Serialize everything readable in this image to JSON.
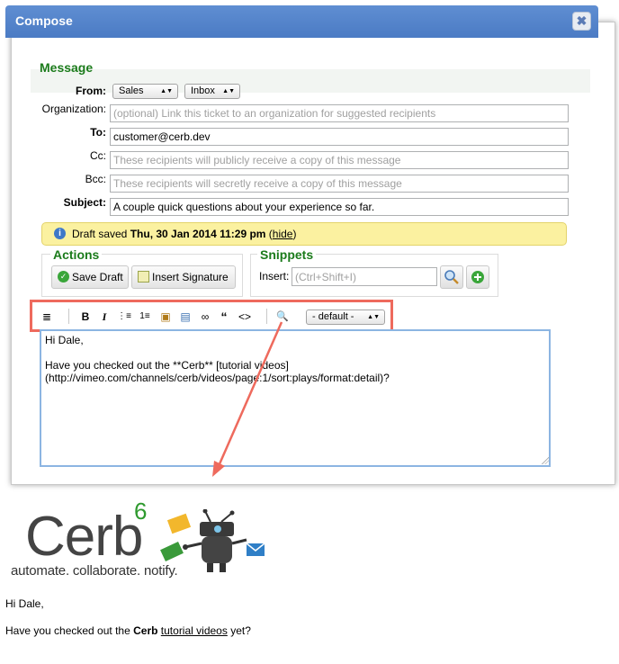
{
  "dialog": {
    "title": "Compose",
    "close_icon": "close-icon",
    "close_glyph": "✖"
  },
  "message": {
    "legend": "Message",
    "from_label": "From:",
    "from_group": "Sales",
    "from_bucket": "Inbox",
    "organization_label": "Organization:",
    "organization_placeholder": "(optional) Link this ticket to an organization for suggested recipients",
    "to_label": "To:",
    "to_value": "customer@cerb.dev",
    "cc_label": "Cc:",
    "cc_placeholder": "These recipients will publicly receive a copy of this message",
    "bcc_label": "Bcc:",
    "bcc_placeholder": "These recipients will secretly receive a copy of this message",
    "subject_label": "Subject:",
    "subject_value": "A couple quick questions about your experience so far."
  },
  "draft": {
    "prefix": "Draft saved",
    "timestamp": "Thu, 30 Jan 2014 11:29 pm",
    "open_paren": "(",
    "hide_label": "hide",
    "close_paren": ")"
  },
  "actions": {
    "legend": "Actions",
    "save_draft": "Save Draft",
    "insert_signature": "Insert Signature"
  },
  "snippets": {
    "legend": "Snippets",
    "insert_label": "Insert:",
    "insert_placeholder": "(Ctrl+Shift+I)"
  },
  "toolbar": {
    "items": [
      "≣",
      "B",
      "I",
      "⋮≡",
      "1≡",
      "▣",
      "▤",
      "∞",
      "“",
      "<>",
      "🔍"
    ],
    "format_value": "- default -"
  },
  "editor": {
    "text": "Hi Dale,\n\nHave you checked out the **Cerb** [tutorial videos]\n(http://vimeo.com/channels/cerb/videos/page:1/sort:plays/format:detail)?"
  },
  "logo": {
    "word": "Cerb",
    "version": "6",
    "tagline": "automate. collaborate. notify."
  },
  "output": {
    "greeting": "Hi Dale,",
    "line_prefix": "Have you checked out the",
    "bold_word": "Cerb",
    "link_text": "tutorial videos",
    "line_suffix": "yet?"
  },
  "colors": {
    "titlebar": "#5a89cf",
    "legend_green": "#1b7b1b",
    "draft_bg": "#fbf1a0",
    "highlight": "#ee6a5d",
    "editor_border": "#8cb5e2"
  }
}
